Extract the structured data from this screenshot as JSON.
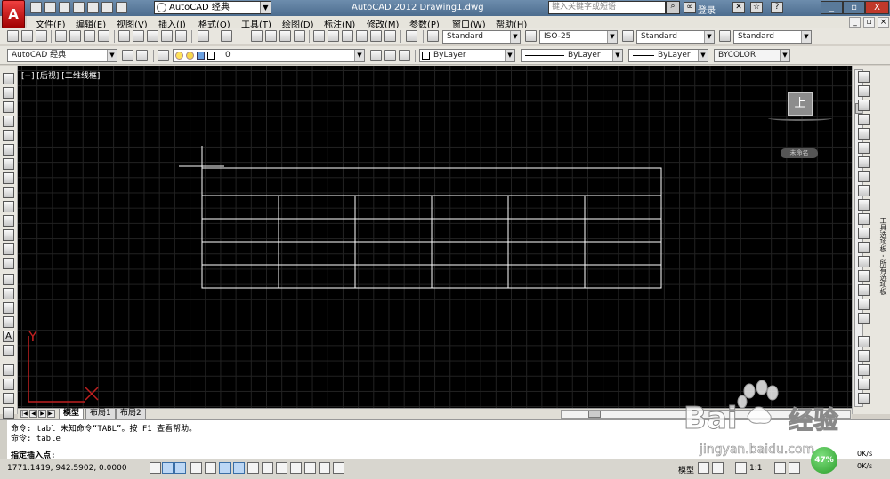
{
  "titlebar": {
    "workspace": "AutoCAD 经典",
    "title": "AutoCAD 2012    Drawing1.dwg",
    "search_placeholder": "键入关键字或短语",
    "login": "登录",
    "close_label": "X"
  },
  "menu": [
    "文件(F)",
    "编辑(E)",
    "视图(V)",
    "插入(I)",
    "格式(O)",
    "工具(T)",
    "绘图(D)",
    "标注(N)",
    "修改(M)",
    "参数(P)",
    "窗口(W)",
    "帮助(H)"
  ],
  "styles": {
    "text_style": "Standard",
    "dim_style": "ISO-25",
    "table_style": "Standard",
    "mleader_style": "Standard"
  },
  "layers": {
    "workspace": "AutoCAD 经典",
    "current_layer": "0",
    "color": "ByLayer",
    "linetype": "ByLayer",
    "lineweight": "ByLayer",
    "plotstyle": "BYCOLOR"
  },
  "viewport": {
    "label": "[−] [后视] [二维线框]",
    "viewcube_face": "上",
    "wcs_label": "未命名",
    "ucs_y": "Y"
  },
  "tabs": [
    "模型",
    "布局1",
    "布局2"
  ],
  "command": {
    "lines": [
      "命令: tabl  未知命令“TABL”。按 F1 查看帮助。",
      "命令: table"
    ],
    "prompt": "指定插入点:"
  },
  "status": {
    "coords": "1771.1419,  942.5902,  0.0000",
    "model": "模型",
    "scale": "1:1"
  },
  "watermark": {
    "brand": "Bai",
    "brand_cn": "经验",
    "url": "jingyan.baidu.com"
  },
  "net": {
    "percent": "47%",
    "up": "0K/s",
    "down": "0K/s"
  },
  "palette_label": "工具选项板 - 所有选项板"
}
